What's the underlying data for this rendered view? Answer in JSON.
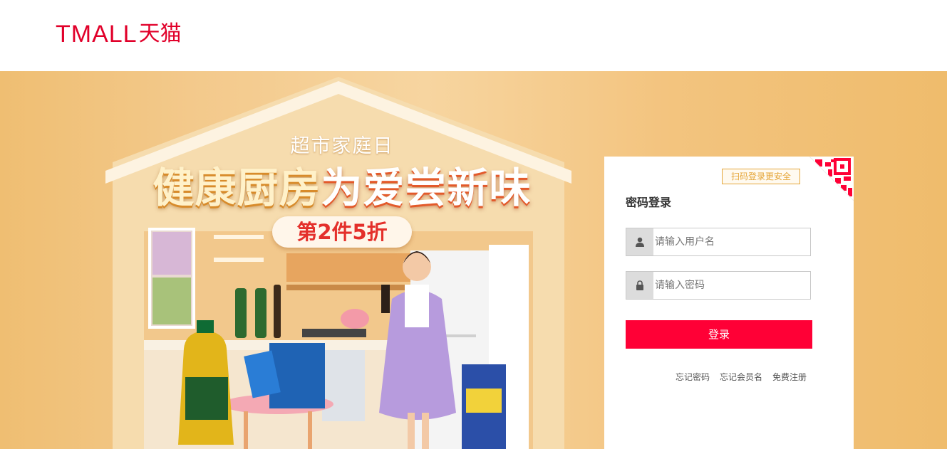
{
  "header": {
    "logo_latin": "TMALL",
    "logo_cn": "天猫"
  },
  "banner": {
    "kicker": "超市家庭日",
    "title_part1": "健康厨房",
    "title_part2": "为爱尝新味",
    "tag": "第2件5折"
  },
  "login": {
    "qr_hint": "扫码登录更安全",
    "title": "密码登录",
    "username_placeholder": "请输入用户名",
    "password_placeholder": "请输入密码",
    "submit_label": "登录",
    "links": {
      "forgot_password": "忘记密码",
      "forgot_member_name": "忘记会员名",
      "register": "免费注册"
    }
  },
  "colors": {
    "brand_red": "#e1002a",
    "submit_red": "#ff0036",
    "banner_orange": "#f3c47f",
    "qr_hint_gold": "#e5a63a"
  },
  "icons": [
    "user-icon",
    "lock-icon",
    "qr-code-icon"
  ]
}
